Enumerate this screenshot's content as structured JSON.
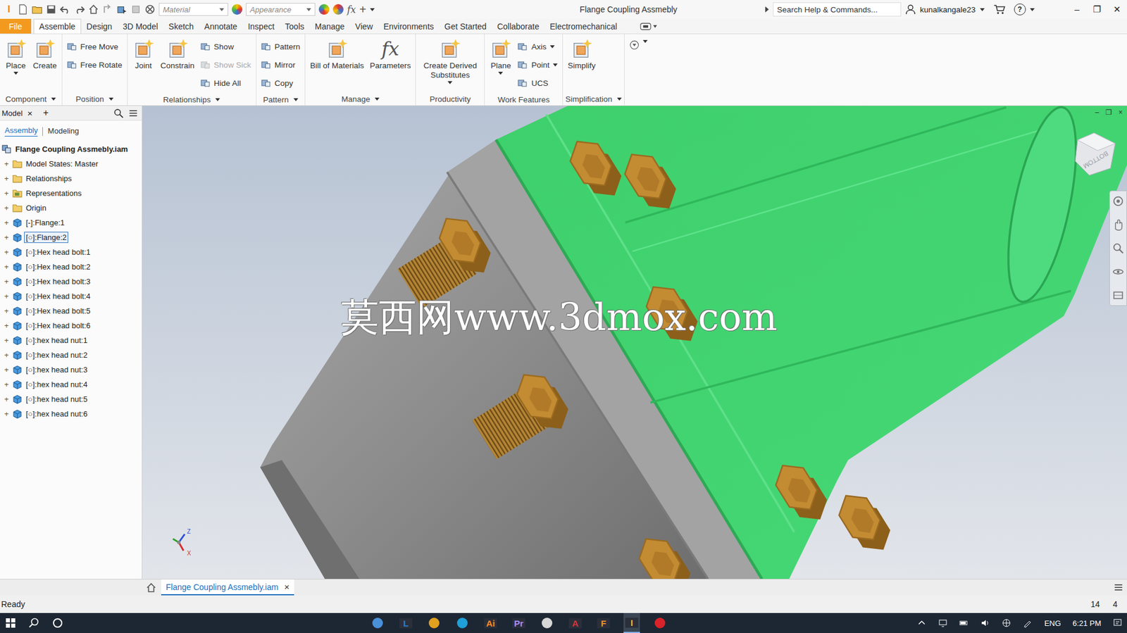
{
  "window": {
    "logo": "I",
    "title": "Flange Coupling Assmebly",
    "material": "Material",
    "appearance": "Appearance",
    "qat_glyphs": [
      "fx",
      "+"
    ],
    "controls": [
      "–",
      "❐",
      "✕"
    ]
  },
  "search": {
    "placeholder": "Search Help & Commands..."
  },
  "user": {
    "name": "kunalkangale23",
    "help": "?"
  },
  "ribbon_tabs": [
    {
      "label": "File",
      "kind": "file",
      "selected": false
    },
    {
      "label": "Assemble",
      "kind": "tab",
      "selected": true
    },
    {
      "label": "Design",
      "kind": "tab",
      "selected": false
    },
    {
      "label": "3D Model",
      "kind": "tab",
      "selected": false
    },
    {
      "label": "Sketch",
      "kind": "tab",
      "selected": false
    },
    {
      "label": "Annotate",
      "kind": "tab",
      "selected": false
    },
    {
      "label": "Inspect",
      "kind": "tab",
      "selected": false
    },
    {
      "label": "Tools",
      "kind": "tab",
      "selected": false
    },
    {
      "label": "Manage",
      "kind": "tab",
      "selected": false
    },
    {
      "label": "View",
      "kind": "tab",
      "selected": false
    },
    {
      "label": "Environments",
      "kind": "tab",
      "selected": false
    },
    {
      "label": "Get Started",
      "kind": "tab",
      "selected": false
    },
    {
      "label": "Collaborate",
      "kind": "tab",
      "selected": false
    },
    {
      "label": "Electromechanical",
      "kind": "tab",
      "selected": false
    }
  ],
  "ribbon": [
    {
      "label": "Component",
      "menu": true,
      "columns": [
        {
          "kind": "large",
          "items": [
            {
              "label": "Place",
              "menu": true,
              "disabled": false
            }
          ]
        },
        {
          "kind": "large",
          "items": [
            {
              "label": "Create",
              "menu": false,
              "disabled": false
            }
          ]
        }
      ]
    },
    {
      "label": "Position",
      "menu": true,
      "columns": [
        {
          "kind": "small",
          "items": [
            {
              "label": "Free Move",
              "menu": false,
              "disabled": false
            },
            {
              "label": "Free Rotate",
              "menu": false,
              "disabled": false
            }
          ]
        }
      ]
    },
    {
      "label": "Relationships",
      "menu": true,
      "columns": [
        {
          "kind": "large",
          "items": [
            {
              "label": "Joint",
              "menu": false,
              "disabled": false
            }
          ]
        },
        {
          "kind": "large",
          "items": [
            {
              "label": "Constrain",
              "menu": false,
              "disabled": false
            }
          ]
        },
        {
          "kind": "small",
          "items": [
            {
              "label": "Show",
              "menu": false,
              "disabled": false
            },
            {
              "label": "Show Sick",
              "menu": false,
              "disabled": true
            },
            {
              "label": "Hide All",
              "menu": false,
              "disabled": false
            }
          ]
        }
      ]
    },
    {
      "label": "Pattern",
      "menu": true,
      "columns": [
        {
          "kind": "small",
          "items": [
            {
              "label": "Pattern",
              "menu": false,
              "disabled": false
            },
            {
              "label": "Mirror",
              "menu": false,
              "disabled": false
            },
            {
              "label": "Copy",
              "menu": false,
              "disabled": false
            }
          ]
        }
      ]
    },
    {
      "label": "Manage",
      "menu": true,
      "columns": [
        {
          "kind": "large",
          "items": [
            {
              "label": "Bill of Materials",
              "menu": false,
              "disabled": false
            }
          ]
        },
        {
          "kind": "large",
          "items": [
            {
              "label": "Parameters",
              "menu": false,
              "disabled": false,
              "glyph": "fx"
            }
          ]
        }
      ]
    },
    {
      "label": "Productivity",
      "menu": false,
      "columns": [
        {
          "kind": "large",
          "items": [
            {
              "label": "Create Derived Substitutes",
              "menu": true,
              "disabled": false
            }
          ]
        }
      ]
    },
    {
      "label": "Work Features",
      "menu": false,
      "columns": [
        {
          "kind": "large",
          "items": [
            {
              "label": "Plane",
              "menu": true,
              "disabled": false
            }
          ]
        },
        {
          "kind": "small",
          "items": [
            {
              "label": "Axis",
              "menu": true,
              "disabled": false
            },
            {
              "label": "Point",
              "menu": true,
              "disabled": false
            },
            {
              "label": "UCS",
              "menu": false,
              "disabled": false
            }
          ]
        }
      ]
    },
    {
      "label": "Simplification",
      "menu": true,
      "columns": [
        {
          "kind": "large",
          "items": [
            {
              "label": "Simplify",
              "menu": false,
              "disabled": false
            }
          ]
        }
      ]
    }
  ],
  "model_browser": {
    "title": "Model",
    "close": "×",
    "add": "+",
    "expander": "+",
    "tabs": [
      {
        "label": "Assembly",
        "selected": true
      },
      {
        "label": "Modeling",
        "selected": false
      }
    ],
    "root": "Flange Coupling Assmebly.iam",
    "items": [
      {
        "label": "Model States: Master",
        "kind": "folder",
        "selected": false
      },
      {
        "label": "Relationships",
        "kind": "folder",
        "selected": false
      },
      {
        "label": "Representations",
        "kind": "representations",
        "selected": false
      },
      {
        "label": "Origin",
        "kind": "folder",
        "selected": false
      },
      {
        "label": "[-]:Flange:1",
        "kind": "part",
        "selected": false
      },
      {
        "label": "[○]:Flange:2",
        "kind": "part",
        "selected": true
      },
      {
        "label": "[○]:Hex head bolt:1",
        "kind": "part",
        "selected": false
      },
      {
        "label": "[○]:Hex head bolt:2",
        "kind": "part",
        "selected": false
      },
      {
        "label": "[○]:Hex head bolt:3",
        "kind": "part",
        "selected": false
      },
      {
        "label": "[○]:Hex head bolt:4",
        "kind": "part",
        "selected": false
      },
      {
        "label": "[○]:Hex head bolt:5",
        "kind": "part",
        "selected": false
      },
      {
        "label": "[○]:Hex head bolt:6",
        "kind": "part",
        "selected": false
      },
      {
        "label": "[○]:hex head nut:1",
        "kind": "part",
        "selected": false
      },
      {
        "label": "[○]:hex head nut:2",
        "kind": "part",
        "selected": false
      },
      {
        "label": "[○]:hex head nut:3",
        "kind": "part",
        "selected": false
      },
      {
        "label": "[○]:hex head nut:4",
        "kind": "part",
        "selected": false
      },
      {
        "label": "[○]:hex head nut:5",
        "kind": "part",
        "selected": false
      },
      {
        "label": "[○]:hex head nut:6",
        "kind": "part",
        "selected": false
      }
    ]
  },
  "viewport": {
    "watermark": "莫西网www.3dmox.com",
    "viewcube": "BOTTOM",
    "controls": [
      "–",
      "❐",
      "×"
    ],
    "triad": [
      {
        "label": "Z",
        "color": "#2a4fd6"
      },
      {
        "label": "X",
        "color": "#d62a2a"
      }
    ]
  },
  "document_tabs": [
    {
      "label": "Flange Coupling Assmebly.iam",
      "selected": true,
      "close": "×"
    }
  ],
  "status_bar": {
    "text": "Ready",
    "values": [
      "14",
      "4"
    ]
  },
  "taskbar": {
    "apps": [
      {
        "kind": "icon",
        "label": "",
        "color": "#4a90d9",
        "active": false
      },
      {
        "kind": "text",
        "label": "L",
        "color": "#2b7bd6",
        "active": false
      },
      {
        "kind": "icon",
        "label": "",
        "color": "#e0a020",
        "active": false
      },
      {
        "kind": "icon",
        "label": "",
        "color": "#1fa0d8",
        "active": false
      },
      {
        "kind": "text",
        "label": "Ai",
        "color": "#ff8a1f",
        "active": false
      },
      {
        "kind": "text",
        "label": "Pr",
        "color": "#a98bff",
        "active": false
      },
      {
        "kind": "icon",
        "label": "",
        "color": "#d6d6d6",
        "active": false
      },
      {
        "kind": "text",
        "label": "A",
        "color": "#d8343a",
        "active": false
      },
      {
        "kind": "text",
        "label": "F",
        "color": "#f0902a",
        "active": false
      },
      {
        "kind": "text",
        "label": "I",
        "color": "#f5b33a",
        "active": true
      },
      {
        "kind": "icon",
        "label": "",
        "color": "#d8232a",
        "active": false
      }
    ],
    "language": "ENG",
    "time": "6:21 PM"
  }
}
